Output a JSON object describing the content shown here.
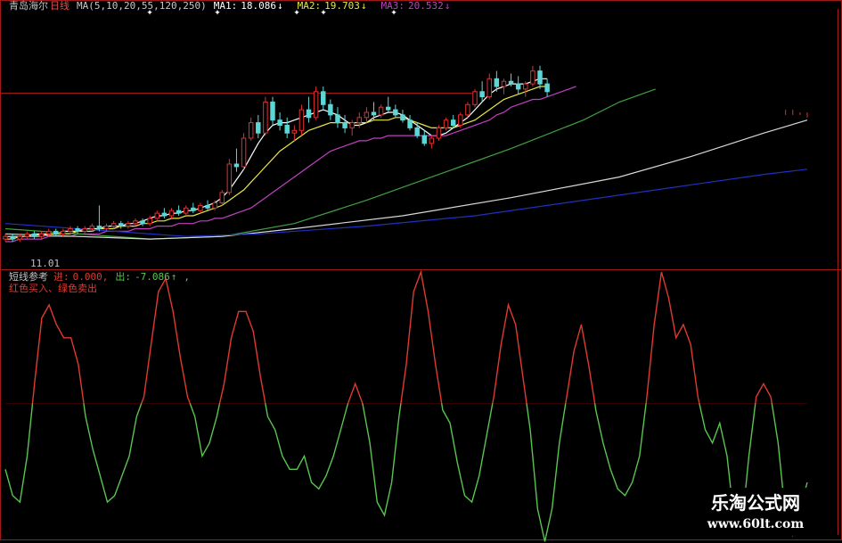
{
  "header": {
    "stock_name": "青岛海尔",
    "period": "日线",
    "ma_params": "MA(5,10,20,55,120,250)",
    "ma1_label": "MA1:",
    "ma1_value": "18.086",
    "ma2_label": "MA2:",
    "ma2_value": "19.703",
    "ma3_label": "MA3:",
    "ma3_value": "20.532",
    "down_arrow": "↓",
    "up_arrow": "↑"
  },
  "date_marker": "11.01",
  "indicator": {
    "name": "短线参考",
    "in_label": "进:",
    "in_value": "0.000,",
    "out_label": "出:",
    "out_value": "-7.086",
    "legend": "红色买入、绿色卖出"
  },
  "watermark": {
    "title": "乐淘公式网",
    "url": "www.60lt.com"
  },
  "colors": {
    "background": "#000000",
    "frame": "#a01818",
    "candle_up": "#e03030",
    "candle_down": "#5dd6d6",
    "ma1": "#ffffff",
    "ma2": "#e8e840",
    "ma3": "#c040c0",
    "ma55": "#40a040",
    "ma120": "#d8d8d8",
    "ma250": "#2030c0",
    "osc_positive": "#e03a30",
    "osc_negative": "#59c450"
  },
  "chart_data": [
    {
      "type": "candlestick",
      "title": "",
      "ylim": [
        14.0,
        24.0
      ],
      "bar_count": 112,
      "candles": [
        [
          15.1,
          15.3,
          15.0,
          15.2
        ],
        [
          15.2,
          15.3,
          15.0,
          15.1
        ],
        [
          15.1,
          15.3,
          15.0,
          15.2
        ],
        [
          15.2,
          15.4,
          15.1,
          15.3
        ],
        [
          15.3,
          15.4,
          15.1,
          15.2
        ],
        [
          15.2,
          15.4,
          15.1,
          15.3
        ],
        [
          15.3,
          15.5,
          15.2,
          15.4
        ],
        [
          15.4,
          15.5,
          15.2,
          15.3
        ],
        [
          15.3,
          15.5,
          15.2,
          15.4
        ],
        [
          15.4,
          15.6,
          15.3,
          15.5
        ],
        [
          15.5,
          15.6,
          15.3,
          15.4
        ],
        [
          15.4,
          15.6,
          15.3,
          15.5
        ],
        [
          15.5,
          15.7,
          15.4,
          15.6
        ],
        [
          15.6,
          16.4,
          15.4,
          15.5
        ],
        [
          15.5,
          15.7,
          15.4,
          15.6
        ],
        [
          15.6,
          15.8,
          15.5,
          15.7
        ],
        [
          15.7,
          15.8,
          15.5,
          15.6
        ],
        [
          15.6,
          15.8,
          15.5,
          15.7
        ],
        [
          15.7,
          15.9,
          15.6,
          15.8
        ],
        [
          15.8,
          15.9,
          15.6,
          15.7
        ],
        [
          15.7,
          16.0,
          15.6,
          15.9
        ],
        [
          15.9,
          16.2,
          15.8,
          16.1
        ],
        [
          16.1,
          16.3,
          15.9,
          16.0
        ],
        [
          16.0,
          16.3,
          15.9,
          16.2
        ],
        [
          16.2,
          16.4,
          16.0,
          16.1
        ],
        [
          16.1,
          16.4,
          16.0,
          16.3
        ],
        [
          16.3,
          16.5,
          16.1,
          16.2
        ],
        [
          16.2,
          16.5,
          16.1,
          16.4
        ],
        [
          16.4,
          16.6,
          16.2,
          16.3
        ],
        [
          16.3,
          16.6,
          16.2,
          16.5
        ],
        [
          16.5,
          17.0,
          16.4,
          16.9
        ],
        [
          16.9,
          18.2,
          16.8,
          18.0
        ],
        [
          18.0,
          18.6,
          17.7,
          17.9
        ],
        [
          17.9,
          19.2,
          17.8,
          19.0
        ],
        [
          19.0,
          19.8,
          18.9,
          19.6
        ],
        [
          19.6,
          19.9,
          19.0,
          19.2
        ],
        [
          19.2,
          20.6,
          19.1,
          20.4
        ],
        [
          20.4,
          20.6,
          19.5,
          19.7
        ],
        [
          19.7,
          20.0,
          19.3,
          19.5
        ],
        [
          19.5,
          19.8,
          19.0,
          19.2
        ],
        [
          19.2,
          19.5,
          18.9,
          19.3
        ],
        [
          19.3,
          20.3,
          19.1,
          20.1
        ],
        [
          20.1,
          20.6,
          19.6,
          19.8
        ],
        [
          19.8,
          21.0,
          19.7,
          20.8
        ],
        [
          20.8,
          21.0,
          20.1,
          20.3
        ],
        [
          20.3,
          20.5,
          19.7,
          19.9
        ],
        [
          19.9,
          20.2,
          19.4,
          19.6
        ],
        [
          19.6,
          19.9,
          19.2,
          19.4
        ],
        [
          19.4,
          19.7,
          19.1,
          19.6
        ],
        [
          19.6,
          20.0,
          19.4,
          19.8
        ],
        [
          19.8,
          20.2,
          19.6,
          20.0
        ],
        [
          20.0,
          20.4,
          19.7,
          19.9
        ],
        [
          19.9,
          20.3,
          19.8,
          20.2
        ],
        [
          20.2,
          20.6,
          20.0,
          20.1
        ],
        [
          20.1,
          20.3,
          19.8,
          19.9
        ],
        [
          19.9,
          20.1,
          19.6,
          19.7
        ],
        [
          19.7,
          19.9,
          19.3,
          19.4
        ],
        [
          19.4,
          19.6,
          19.0,
          19.1
        ],
        [
          19.1,
          19.3,
          18.7,
          18.8
        ],
        [
          18.8,
          19.1,
          18.6,
          19.0
        ],
        [
          19.0,
          19.5,
          18.9,
          19.4
        ],
        [
          19.4,
          19.8,
          19.3,
          19.7
        ],
        [
          19.7,
          19.9,
          19.4,
          19.5
        ],
        [
          19.5,
          20.0,
          19.4,
          19.9
        ],
        [
          19.9,
          20.4,
          19.8,
          20.3
        ],
        [
          20.3,
          20.9,
          20.2,
          20.8
        ],
        [
          20.8,
          21.2,
          20.4,
          20.6
        ],
        [
          20.6,
          21.5,
          20.5,
          21.3
        ],
        [
          21.3,
          21.6,
          20.8,
          21.0
        ],
        [
          21.0,
          21.3,
          20.7,
          21.2
        ],
        [
          21.2,
          21.5,
          21.0,
          21.1
        ],
        [
          21.1,
          21.4,
          20.7,
          20.9
        ],
        [
          20.9,
          21.2,
          20.6,
          21.1
        ],
        [
          21.1,
          21.8,
          21.0,
          21.6
        ],
        [
          21.6,
          21.8,
          20.9,
          21.1
        ],
        [
          21.1,
          21.3,
          20.6,
          20.8
        ]
      ],
      "moving_averages": [
        {
          "label": "MA1",
          "color_key": "ma1",
          "values": [
            15.2,
            15.2,
            15.2,
            15.2,
            15.3,
            15.3,
            15.3,
            15.3,
            15.4,
            15.4,
            15.4,
            15.5,
            15.5,
            15.5,
            15.6,
            15.6,
            15.6,
            15.7,
            15.7,
            15.8,
            15.9,
            16.0,
            16.0,
            16.1,
            16.1,
            16.2,
            16.2,
            16.3,
            16.4,
            16.5,
            16.7,
            17.0,
            17.4,
            17.8,
            18.3,
            18.8,
            19.2,
            19.5,
            19.6,
            19.6,
            19.7,
            19.8,
            19.9,
            20.0,
            20.1,
            20.0,
            19.9,
            19.7,
            19.5,
            19.5,
            19.6,
            19.8,
            19.9,
            20.0,
            20.0,
            19.9,
            19.7,
            19.5,
            19.3,
            19.1,
            19.1,
            19.2,
            19.4,
            19.6,
            19.8,
            20.1,
            20.4,
            20.7,
            20.9,
            21.0,
            21.1,
            21.1,
            21.1,
            21.2,
            21.3,
            21.3
          ]
        },
        {
          "label": "MA2",
          "color_key": "ma2",
          "values": [
            15.1,
            15.1,
            15.2,
            15.2,
            15.2,
            15.2,
            15.3,
            15.3,
            15.3,
            15.3,
            15.4,
            15.4,
            15.4,
            15.5,
            15.5,
            15.5,
            15.6,
            15.6,
            15.6,
            15.7,
            15.7,
            15.8,
            15.8,
            15.9,
            15.9,
            16.0,
            16.0,
            16.1,
            16.2,
            16.3,
            16.4,
            16.6,
            16.8,
            17.0,
            17.3,
            17.6,
            17.9,
            18.2,
            18.5,
            18.7,
            18.9,
            19.1,
            19.3,
            19.4,
            19.5,
            19.6,
            19.6,
            19.6,
            19.6,
            19.6,
            19.6,
            19.7,
            19.7,
            19.7,
            19.8,
            19.8,
            19.7,
            19.6,
            19.5,
            19.4,
            19.4,
            19.4,
            19.4,
            19.5,
            19.6,
            19.7,
            19.9,
            20.1,
            20.3,
            20.5,
            20.6,
            20.7,
            20.8,
            20.9,
            21.0,
            21.0
          ]
        },
        {
          "label": "MA3",
          "color_key": "ma3",
          "values": [
            15.0,
            15.0,
            15.1,
            15.1,
            15.1,
            15.1,
            15.2,
            15.2,
            15.2,
            15.2,
            15.3,
            15.3,
            15.3,
            15.3,
            15.4,
            15.4,
            15.4,
            15.4,
            15.5,
            15.5,
            15.5,
            15.6,
            15.6,
            15.6,
            15.7,
            15.7,
            15.7,
            15.8,
            15.8,
            15.9,
            15.9,
            16.0,
            16.1,
            16.2,
            16.3,
            16.5,
            16.7,
            16.9,
            17.1,
            17.3,
            17.5,
            17.7,
            17.9,
            18.1,
            18.3,
            18.5,
            18.6,
            18.7,
            18.8,
            18.9,
            18.9,
            19.0,
            19.0,
            19.1,
            19.1,
            19.1,
            19.1,
            19.1,
            19.1,
            19.1,
            19.1,
            19.1,
            19.2,
            19.3,
            19.4,
            19.5,
            19.6,
            19.7,
            19.9,
            20.0,
            20.2,
            20.3,
            20.4,
            20.5,
            20.5,
            20.6,
            20.7,
            20.8,
            20.9,
            21.0
          ]
        },
        {
          "label": "MA55",
          "color_key": "ma55",
          "points": [
            [
              0,
              15.5
            ],
            [
              10,
              15.3
            ],
            [
              20,
              15.1
            ],
            [
              30,
              15.2
            ],
            [
              40,
              15.7
            ],
            [
              50,
              16.6
            ],
            [
              60,
              17.6
            ],
            [
              70,
              18.6
            ],
            [
              80,
              19.7
            ],
            [
              85,
              20.4
            ],
            [
              90,
              20.9
            ]
          ]
        },
        {
          "label": "MA120",
          "color_key": "ma120",
          "points": [
            [
              0,
              15.3
            ],
            [
              20,
              15.1
            ],
            [
              30,
              15.2
            ],
            [
              40,
              15.5
            ],
            [
              55,
              16.0
            ],
            [
              70,
              16.7
            ],
            [
              85,
              17.5
            ],
            [
              95,
              18.3
            ],
            [
              105,
              19.2
            ],
            [
              111,
              19.7
            ]
          ]
        },
        {
          "label": "MA250",
          "color_key": "ma250",
          "points": [
            [
              0,
              15.7
            ],
            [
              15,
              15.4
            ],
            [
              25,
              15.2
            ],
            [
              35,
              15.3
            ],
            [
              50,
              15.6
            ],
            [
              65,
              16.0
            ],
            [
              80,
              16.6
            ],
            [
              95,
              17.2
            ],
            [
              105,
              17.6
            ],
            [
              111,
              17.8
            ]
          ]
        }
      ],
      "tail_ticks": [
        [
          108,
          19.9,
          20.1
        ],
        [
          109,
          19.9,
          20.1
        ],
        [
          110,
          19.9,
          20.0
        ],
        [
          111,
          19.8,
          20.0
        ]
      ]
    },
    {
      "type": "line",
      "title": "短线参考",
      "ylim": [
        -10,
        10
      ],
      "zero_line": 0,
      "bar_count": 112,
      "series": [
        {
          "name": "进",
          "color_key": "osc_positive",
          "sign": "positive"
        },
        {
          "name": "出",
          "color_key": "osc_negative",
          "sign": "negative"
        }
      ],
      "values": [
        -5.0,
        -7.0,
        -7.5,
        -4.0,
        1.5,
        6.5,
        7.5,
        6.0,
        5.0,
        5.0,
        3.0,
        -1.0,
        -3.5,
        -5.5,
        -7.5,
        -7.0,
        -5.5,
        -4.0,
        -1.0,
        0.5,
        4.5,
        8.5,
        9.5,
        7.0,
        3.5,
        0.5,
        -1.0,
        -4.0,
        -3.0,
        -1.0,
        1.5,
        5.0,
        7.0,
        7.0,
        5.5,
        2.0,
        -1.0,
        -2.0,
        -4.0,
        -5.0,
        -5.0,
        -4.0,
        -6.0,
        -6.5,
        -5.5,
        -4.0,
        -2.0,
        0.0,
        1.5,
        0.0,
        -3.0,
        -7.5,
        -8.5,
        -6.0,
        -1.0,
        3.0,
        8.5,
        10.0,
        7.0,
        3.0,
        -0.5,
        -1.5,
        -4.5,
        -7.0,
        -7.5,
        -5.5,
        -2.5,
        0.5,
        4.5,
        7.5,
        6.0,
        2.0,
        -2.0,
        -8.0,
        -10.5,
        -8.0,
        -3.0,
        0.5,
        4.0,
        6.0,
        3.0,
        -0.5,
        -3.0,
        -5.0,
        -6.5,
        -7.0,
        -6.0,
        -4.0,
        0.5,
        6.0,
        10.0,
        8.0,
        5.0,
        6.0,
        4.5,
        0.5,
        -2.0,
        -3.0,
        -1.5,
        -4.0,
        -9.0,
        -9.5,
        -4.0,
        0.5,
        1.5,
        0.5,
        -3.0,
        -8.5,
        -10.0,
        -8.0,
        -6.0
      ]
    }
  ]
}
